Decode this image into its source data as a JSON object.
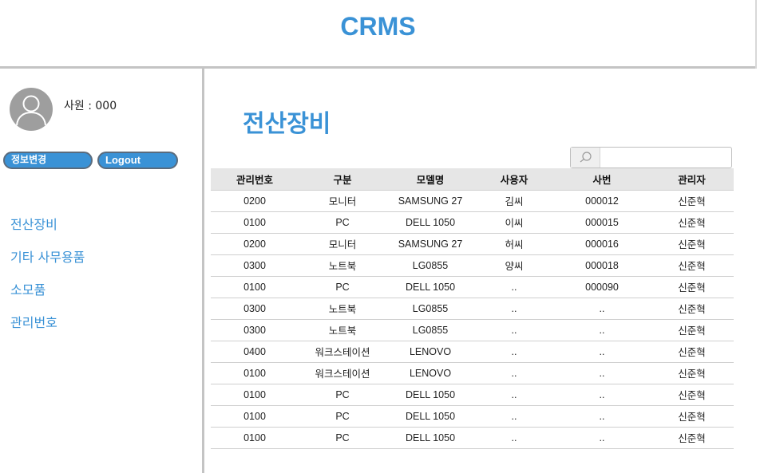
{
  "header": {
    "title": "CRMS"
  },
  "sidebar": {
    "user_label": "사원 : 000",
    "edit_button": "정보변경",
    "logout_button": "Logout",
    "nav": [
      {
        "label": "전산장비"
      },
      {
        "label": "기타 사무용품"
      },
      {
        "label": "소모품"
      },
      {
        "label": "관리번호"
      }
    ]
  },
  "main": {
    "title": "전산장비",
    "search": {
      "value": "",
      "placeholder": ""
    },
    "columns": [
      "관리번호",
      "구분",
      "모델명",
      "사용자",
      "사번",
      "관리자"
    ],
    "rows": [
      [
        "0200",
        "모니터",
        "SAMSUNG 27",
        "김씨",
        "000012",
        "신준혁"
      ],
      [
        "0100",
        "PC",
        "DELL 1050",
        "이씨",
        "000015",
        "신준혁"
      ],
      [
        "0200",
        "모니터",
        "SAMSUNG 27",
        "허씨",
        "000016",
        "신준혁"
      ],
      [
        "0300",
        "노트북",
        "LG0855",
        "양씨",
        "000018",
        "신준혁"
      ],
      [
        "0100",
        "PC",
        "DELL 1050",
        "..",
        "000090",
        "신준혁"
      ],
      [
        "0300",
        "노트북",
        "LG0855",
        "..",
        "..",
        "신준혁"
      ],
      [
        "0300",
        "노트북",
        "LG0855",
        "..",
        "..",
        "신준혁"
      ],
      [
        "0400",
        "워크스테이션",
        "LENOVO",
        "..",
        "..",
        "신준혁"
      ],
      [
        "0100",
        "워크스테이션",
        "LENOVO",
        "..",
        "..",
        "신준혁"
      ],
      [
        "0100",
        "PC",
        "DELL 1050",
        "..",
        "..",
        "신준혁"
      ],
      [
        "0100",
        "PC",
        "DELL 1050",
        "..",
        "..",
        "신준혁"
      ],
      [
        "0100",
        "PC",
        "DELL 1050",
        "..",
        "..",
        "신준혁"
      ]
    ]
  },
  "colors": {
    "accent": "#3a92d6",
    "divider": "#c4c4c4",
    "header_row": "#e6e6e6"
  },
  "icons": {
    "avatar": "user-silhouette-icon",
    "search": "magnifier-icon"
  }
}
